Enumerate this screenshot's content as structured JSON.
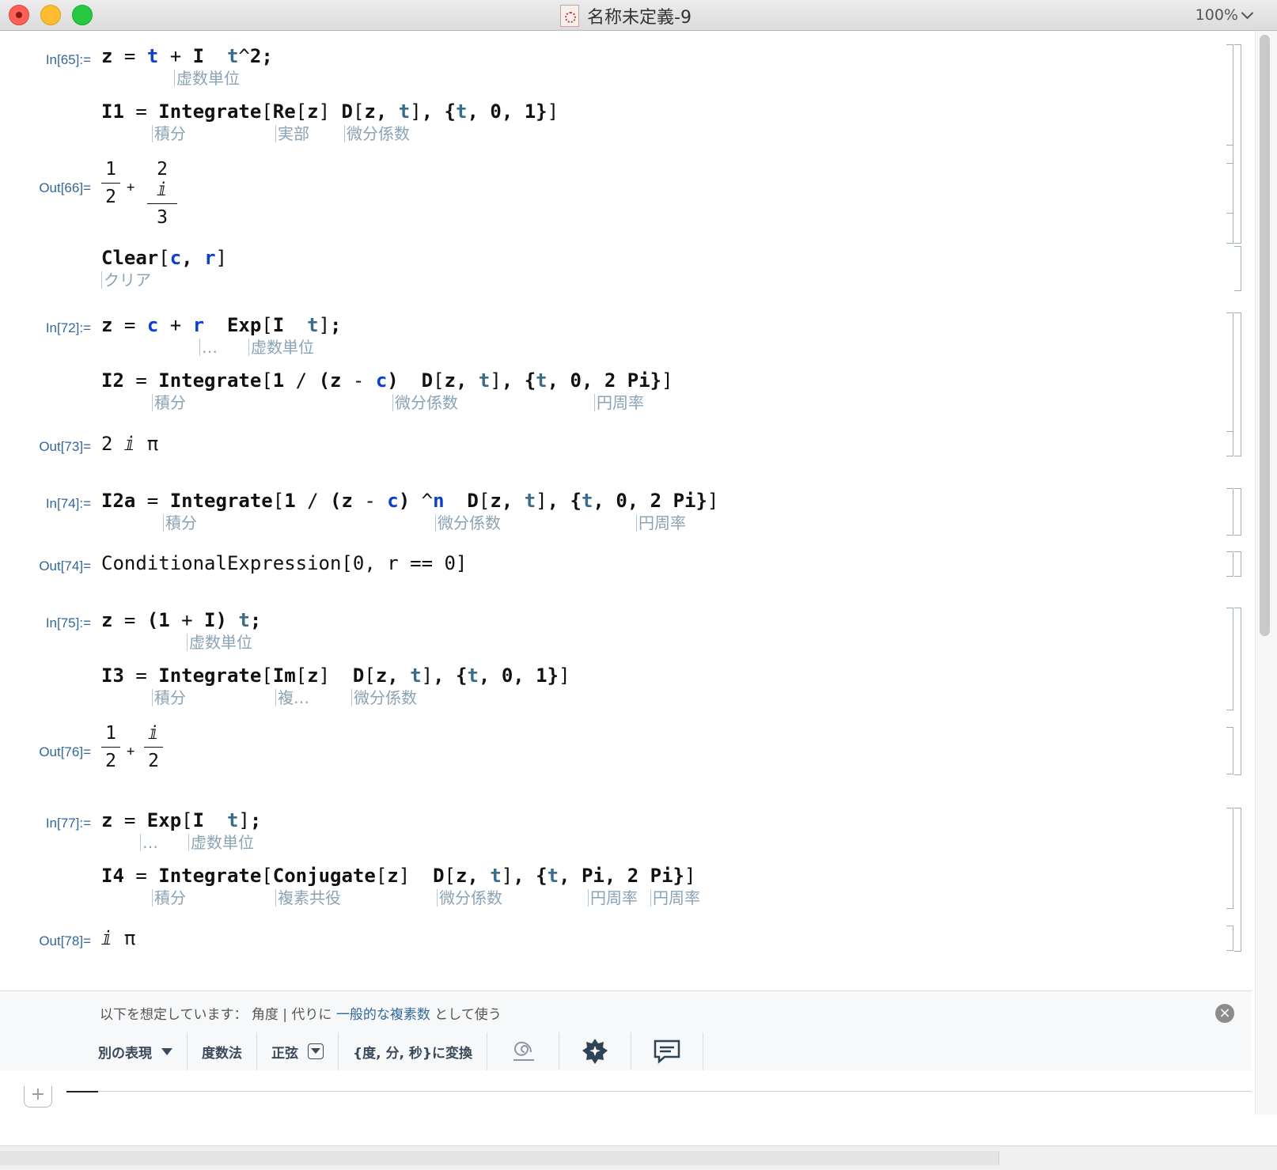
{
  "window": {
    "title": "名称未定義-9",
    "zoom": "100%"
  },
  "cells": {
    "in65": {
      "label": "In[65]:="
    },
    "out66": {
      "label": "Out[66]=",
      "num1": "1",
      "den1": "2",
      "num2": "2 ⅈ",
      "den2": "3"
    },
    "in72": {
      "label": "In[72]:="
    },
    "out73": {
      "label": "Out[73]=",
      "value": "2 ⅈ π"
    },
    "in74": {
      "label": "In[74]:="
    },
    "out74": {
      "label": "Out[74]=",
      "value": "ConditionalExpression[0, r == 0]"
    },
    "in75": {
      "label": "In[75]:="
    },
    "out76": {
      "label": "Out[76]=",
      "num1": "1",
      "den1": "2",
      "num2": "ⅈ",
      "den2": "2"
    },
    "in77": {
      "label": "In[77]:="
    },
    "out78": {
      "label": "Out[78]=",
      "value": "ⅈ π"
    }
  },
  "hints": {
    "imaginary_unit": "虚数単位",
    "integrate": "積分",
    "real_part": "実部",
    "derivative": "微分係数",
    "clear": "クリア",
    "ellipsis": "…",
    "pi": "円周率",
    "complex_trunc": "複…",
    "conjugate": "複素共役"
  },
  "suggestions": {
    "assumption_prefix": "以下を想定しています： 角度 | 代りに ",
    "assumption_link": "一般的な複素数",
    "assumption_suffix": " として使う",
    "tools": [
      "別の表現",
      "度数法",
      "正弦",
      "{度, 分, 秒}に変換"
    ],
    "icons": [
      "spiral-icon",
      "gear-badge-icon",
      "chat-icon"
    ]
  }
}
